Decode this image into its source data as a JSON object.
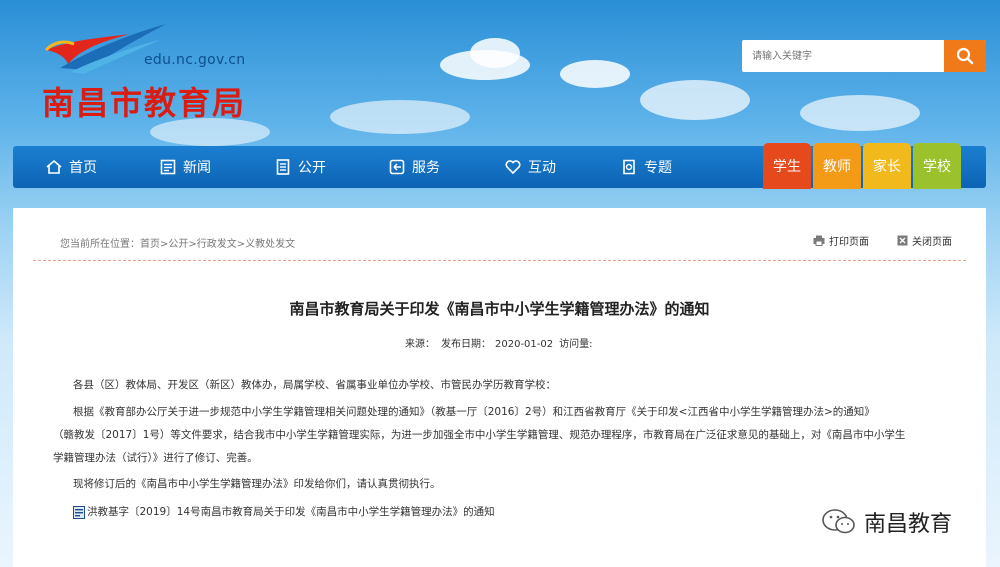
{
  "header": {
    "domain": "edu.nc.gov.cn",
    "site_title": "南昌市教育局",
    "search_placeholder": "请输入关键字",
    "search_icon": "search-icon"
  },
  "nav": {
    "items": [
      {
        "label": "首页",
        "icon": "home-icon"
      },
      {
        "label": "新闻",
        "icon": "news-icon"
      },
      {
        "label": "公开",
        "icon": "document-icon"
      },
      {
        "label": "服务",
        "icon": "service-icon"
      },
      {
        "label": "互动",
        "icon": "heart-icon"
      },
      {
        "label": "专题",
        "icon": "topic-icon"
      }
    ],
    "quick_links": [
      {
        "label": "学生",
        "color": "#e64a1c"
      },
      {
        "label": "教师",
        "color": "#f39a16"
      },
      {
        "label": "家长",
        "color": "#f2b91c"
      },
      {
        "label": "学校",
        "color": "#9bc22c"
      }
    ]
  },
  "breadcrumb": {
    "prefix": "您当前所在位置：",
    "path": "首页>公开>行政发文>义教处发文"
  },
  "tools": {
    "print": "打印页面",
    "close": "关闭页面"
  },
  "article": {
    "title": "南昌市教育局关于印发《南昌市中小学生学籍管理办法》的通知",
    "source_label": "来源：",
    "date_label": "发布日期：",
    "date": "2020-01-02",
    "views_label": "访问量:",
    "p1": "各县（区）教体局、开发区（新区）教体办，局属学校、省属事业单位办学校、市管民办学历教育学校：",
    "p2_line1": "根据《教育部办公厅关于进一步规范中小学生学籍管理相关问题处理的通知》（教基一厅〔2016〕2号）和江西省教育厅《关于印发<江西省中小学生学籍管理办法>的通知》",
    "p2_line2": "（赣教发〔2017〕1号）等文件要求，结合我市中小学生学籍管理实际，为进一步加强全市中小学生学籍管理、规范办理程序，市教育局在广泛征求意见的基础上，对《南昌市中小学生",
    "p2_line3": "学籍管理办法（试行）》进行了修订、完善。",
    "p3": "现将修订后的《南昌市中小学生学籍管理办法》印发给你们，请认真贯彻执行。",
    "attachment": "洪教基字〔2019〕14号南昌市教育局关于印发《南昌市中小学生学籍管理办法》的通知"
  },
  "watermark": "南昌教育"
}
